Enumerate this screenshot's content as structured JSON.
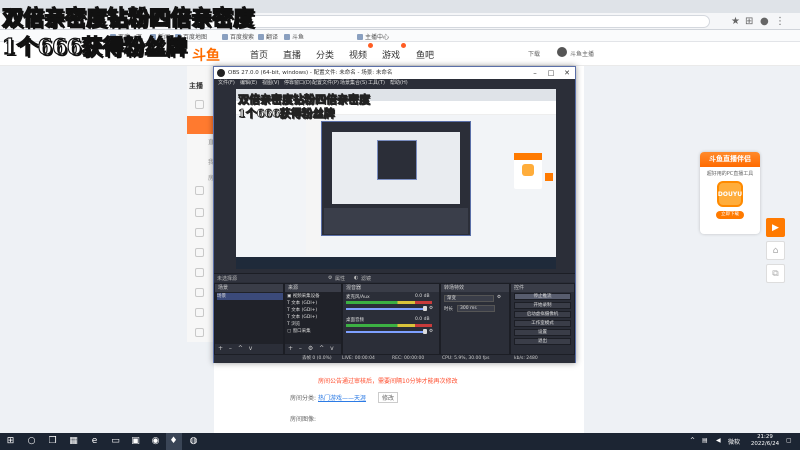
{
  "overlay": {
    "line1": "双倍亲密度钻粉四倍亲密度",
    "line2": "1个666获得粉丝牌"
  },
  "bookmarks": [
    "百度一下",
    "新闻",
    "百度地图",
    "百度搜索",
    "翻译",
    "斗鱼",
    "主播中心"
  ],
  "site_nav": {
    "items": [
      "首页",
      "直播",
      "分类",
      "视频",
      "游戏",
      "鱼吧"
    ],
    "upload": "下载",
    "username": "斗鱼主播"
  },
  "sidebar": {
    "title": "主播",
    "subs": [
      "直",
      "我",
      "房"
    ]
  },
  "page": {
    "notice": "房间公告通过审核后，需要间隔10分钟才能再次修改",
    "room_link_label": "房间分类:",
    "room_link": "热门游戏——天涯",
    "modify_btn": "修改",
    "room_pic_label": "房间图像:"
  },
  "promo": {
    "title": "斗鱼直播伴侣",
    "subtitle": "超好用的PC直播工具",
    "mascot": "DOUYU",
    "button": "立即下载"
  },
  "obs": {
    "title": "OBS 27.0.0 (64-bit, windows) - 配置文件: 未命名 - 场景: 未命名",
    "menu": [
      "文件(F)",
      "编辑(E)",
      "视图(V)",
      "停靠窗口(D)",
      "配置文件(P)",
      "场景集合(S)",
      "工具(T)",
      "帮助(H)"
    ],
    "mid_left": "未选择源",
    "mid_props": "属性",
    "mid_filters": "滤镜",
    "docks": {
      "scenes": {
        "title": "场景",
        "item": "场景"
      },
      "sources": {
        "title": "来源",
        "items": [
          "视频采集设备",
          "文本 (GDI+)",
          "文本 (GDI+)",
          "文本 (GDI+)",
          "浏览",
          "窗口采集"
        ]
      },
      "mixer": {
        "title": "混音器",
        "ch1": "麦克风/Aux",
        "ch1_db": "0.0 dB",
        "ch2": "桌面音频",
        "ch2_db": "0.0 dB"
      },
      "transitions": {
        "title": "转场特效",
        "type": "渐变",
        "duration_label": "时长",
        "duration": "300 ms"
      },
      "controls": {
        "title": "控件",
        "buttons": [
          "停止推流",
          "开始录制",
          "启动虚拟摄像机",
          "工作室模式",
          "设置",
          "退出"
        ]
      }
    },
    "status": {
      "dropped": "丢帧 0 (0.0%)",
      "live": "LIVE: 00:00:04",
      "rec": "REC: 00:00:00",
      "cpu": "CPU: 5.9%, 30.00 fps",
      "kbps": "kb/s: 2480"
    }
  },
  "taskbar": {
    "ime": "微软",
    "time": "21:29",
    "date": "2022/6/24"
  },
  "colors": {
    "accent": "#ff7a00",
    "obs_bg": "#2b2e38",
    "taskbar": "#1c2533"
  }
}
